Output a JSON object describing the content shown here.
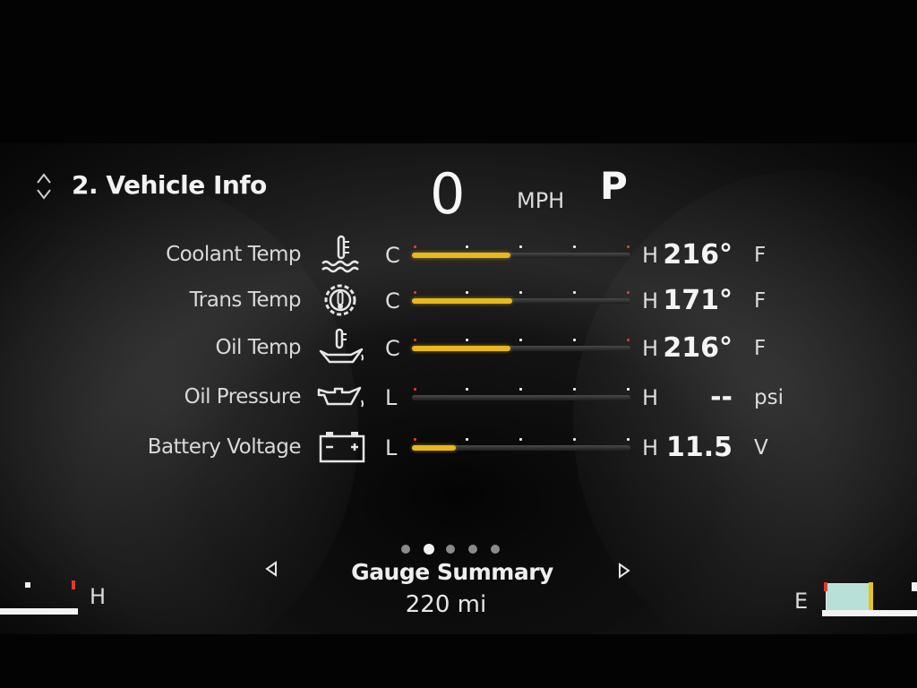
{
  "header": {
    "title": "2. Vehicle Info",
    "speed": "0",
    "speed_unit": "MPH",
    "gear": "P"
  },
  "gauges": [
    {
      "label": "Coolant Temp",
      "icon": "coolant-temp-icon",
      "low": "C",
      "high": "H",
      "value": "216°",
      "unit": "F",
      "level": 0.45
    },
    {
      "label": "Trans Temp",
      "icon": "trans-temp-icon",
      "low": "C",
      "high": "H",
      "value": "171°",
      "unit": "F",
      "level": 0.46
    },
    {
      "label": "Oil Temp",
      "icon": "oil-temp-icon",
      "low": "C",
      "high": "H",
      "value": "216°",
      "unit": "F",
      "level": 0.45
    },
    {
      "label": "Oil Pressure",
      "icon": "oil-pressure-icon",
      "low": "L",
      "high": "H",
      "value": "--",
      "unit": "psi",
      "level": 0
    },
    {
      "label": "Battery Voltage",
      "icon": "battery-icon",
      "low": "L",
      "high": "H",
      "value": "11.5",
      "unit": "V",
      "level": 0.2
    }
  ],
  "footer": {
    "page_count": 5,
    "active_page": 2,
    "title": "Gauge Summary",
    "range": "220 mi"
  },
  "side_gauges": {
    "temp_label": "H",
    "fuel_label": "E"
  },
  "colors": {
    "accent": "#e8b81c",
    "warn": "#e23a2a",
    "fuel": "#b8e0d8"
  }
}
